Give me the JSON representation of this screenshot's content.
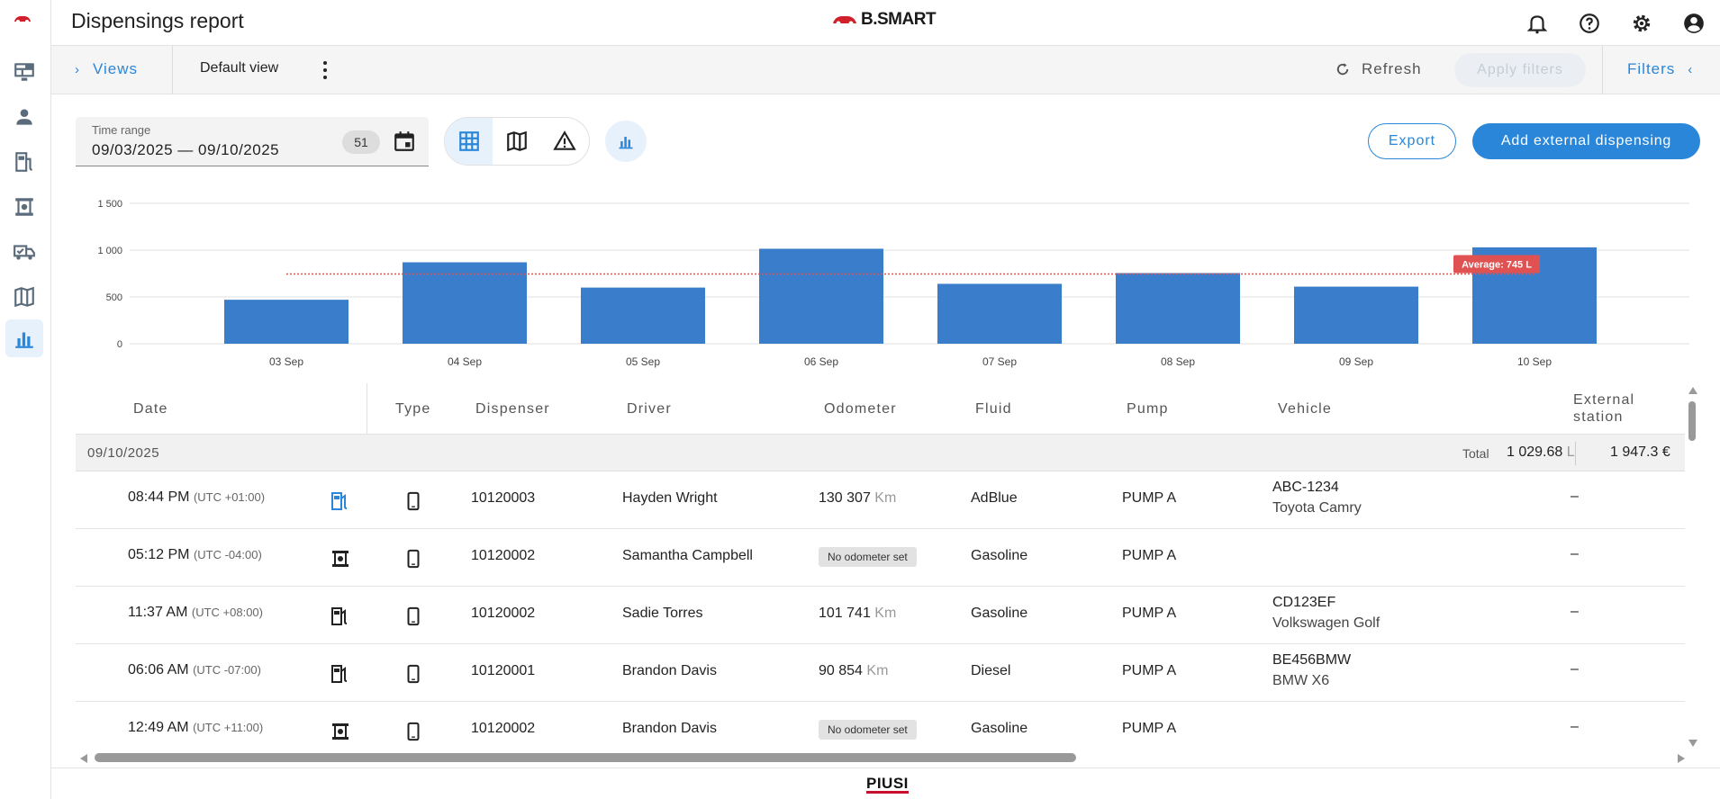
{
  "header": {
    "title": "Dispensings report",
    "brand": "B.SMART"
  },
  "sidebar": {
    "items": [
      {
        "icon": "monitor-icon"
      },
      {
        "icon": "person-icon"
      },
      {
        "icon": "fuel-station-icon"
      },
      {
        "icon": "dispenser-icon"
      },
      {
        "icon": "truck-check-icon"
      },
      {
        "icon": "map-icon"
      },
      {
        "icon": "bar-chart-icon",
        "active": true
      }
    ]
  },
  "toolbar": {
    "views_label": "Views",
    "default_view": "Default view",
    "refresh_label": "Refresh",
    "apply_filters_label": "Apply filters",
    "filters_label": "Filters"
  },
  "controls": {
    "time_range_label": "Time range",
    "time_range_value": "09/03/2025 — 09/10/2025",
    "count_badge": "51",
    "export_label": "Export",
    "add_label": "Add external dispensing"
  },
  "chart_data": {
    "type": "bar",
    "categories": [
      "03 Sep",
      "04 Sep",
      "05 Sep",
      "06 Sep",
      "07 Sep",
      "08 Sep",
      "09 Sep",
      "10 Sep"
    ],
    "values": [
      470,
      870,
      600,
      1015,
      640,
      755,
      610,
      1030
    ],
    "ylim": [
      0,
      1500
    ],
    "yticks": [
      "0",
      "500",
      "1 000",
      "1 500"
    ],
    "average": 745,
    "average_label": "Average: 745 L",
    "bar_color": "#3a7ecb",
    "average_color": "#e05252",
    "grid": true
  },
  "table": {
    "columns": [
      "Date",
      "Type",
      "Dispenser",
      "Driver",
      "Odometer",
      "Fluid",
      "Pump",
      "Vehicle",
      "External station"
    ],
    "group": {
      "date": "09/10/2025",
      "total_label": "Total",
      "total_liters": "1 029.68",
      "liters_unit": "L",
      "total_euros": "1 947.3 €"
    },
    "rows": [
      {
        "time": "08:44 PM",
        "tz": "(UTC +01:00)",
        "source_icon": "fuel-nozzle-blue-icon",
        "disp": "10120003",
        "driver": "Hayden Wright",
        "odo": "130 307",
        "odo_unit": "Km",
        "fluid": "AdBlue",
        "pump": "PUMP A",
        "plate": "ABC-1234",
        "model": "Toyota Camry",
        "ext": "–"
      },
      {
        "time": "05:12 PM",
        "tz": "(UTC -04:00)",
        "source_icon": "dispenser-icon",
        "disp": "10120002",
        "driver": "Samantha Campbell",
        "odo_badge": "No odometer set",
        "fluid": "Gasoline",
        "pump": "PUMP A",
        "ext": "–"
      },
      {
        "time": "11:37 AM",
        "tz": "(UTC +08:00)",
        "source_icon": "fuel-nozzle-icon",
        "disp": "10120002",
        "driver": "Sadie Torres",
        "odo": "101 741",
        "odo_unit": "Km",
        "fluid": "Gasoline",
        "pump": "PUMP A",
        "plate": "CD123EF",
        "model": "Volkswagen Golf",
        "ext": "–"
      },
      {
        "time": "06:06 AM",
        "tz": "(UTC -07:00)",
        "source_icon": "fuel-nozzle-icon",
        "disp": "10120001",
        "driver": "Brandon Davis",
        "odo": "90 854",
        "odo_unit": "Km",
        "fluid": "Diesel",
        "pump": "PUMP A",
        "plate": "BE456BMW",
        "model": "BMW X6",
        "ext": "–"
      },
      {
        "time": "12:49 AM",
        "tz": "(UTC +11:00)",
        "source_icon": "dispenser-icon",
        "disp": "10120002",
        "driver": "Brandon Davis",
        "odo_badge": "No odometer set",
        "fluid": "Gasoline",
        "pump": "PUMP A",
        "ext": "–"
      }
    ]
  },
  "footer": {
    "logo": "PIUSI"
  }
}
